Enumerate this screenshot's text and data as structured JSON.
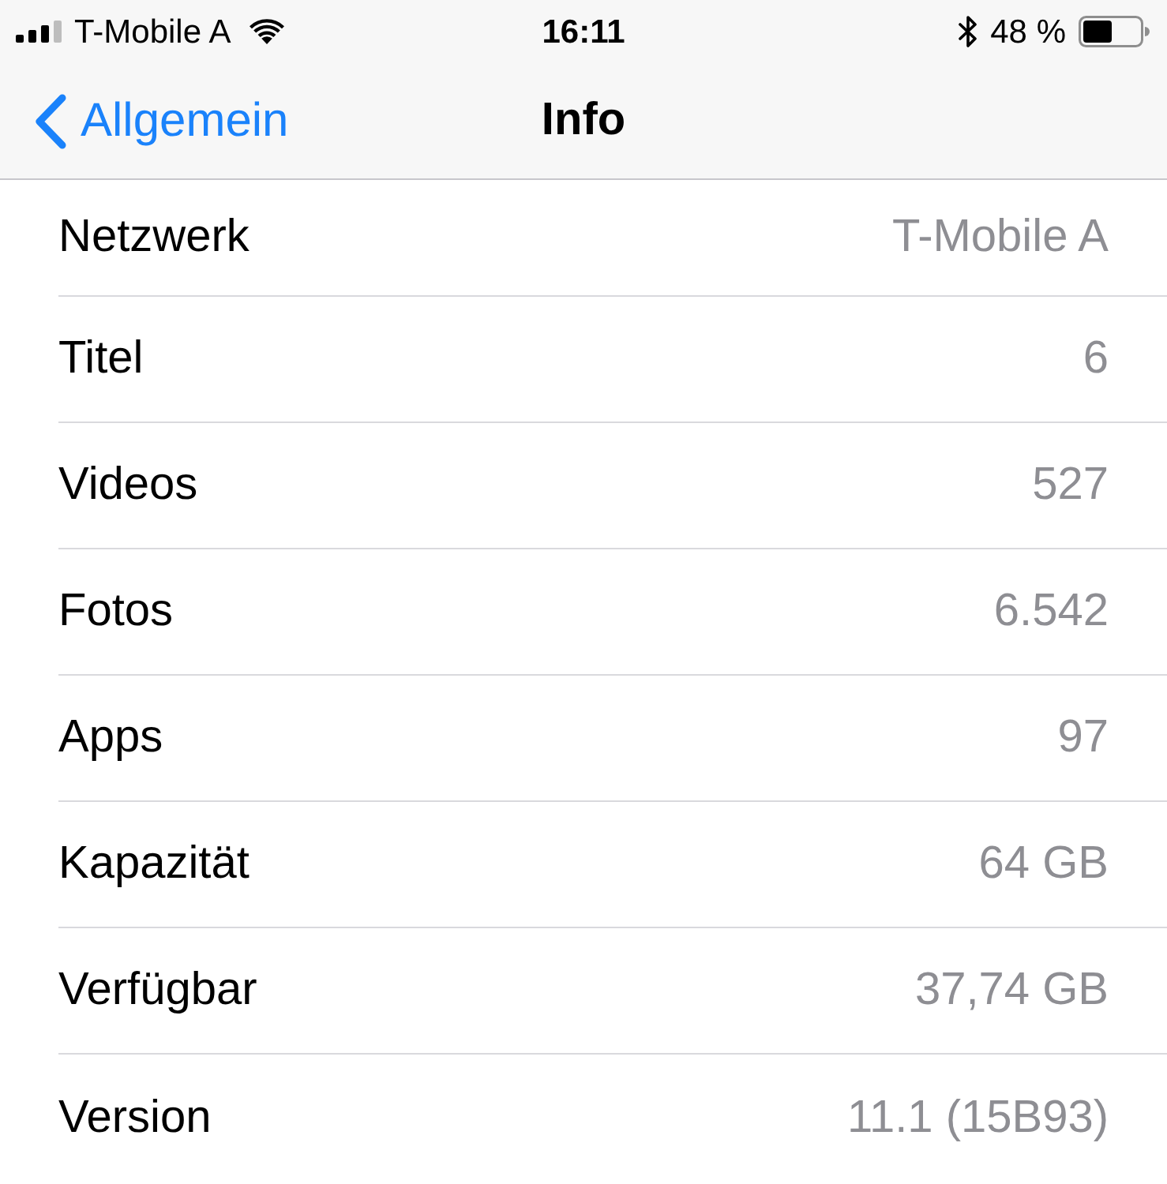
{
  "status_bar": {
    "carrier": "T-Mobile A",
    "time": "16:11",
    "battery_percent": "48 %"
  },
  "nav_bar": {
    "back_label": "Allgemein",
    "title": "Info"
  },
  "rows": [
    {
      "label": "Netzwerk",
      "value": "T-Mobile A"
    },
    {
      "label": "Titel",
      "value": "6"
    },
    {
      "label": "Videos",
      "value": "527"
    },
    {
      "label": "Fotos",
      "value": "6.542"
    },
    {
      "label": "Apps",
      "value": "97"
    },
    {
      "label": "Kapazität",
      "value": "64 GB"
    },
    {
      "label": "Verfügbar",
      "value": "37,74 GB"
    },
    {
      "label": "Version",
      "value": "11.1 (15B93)"
    }
  ]
}
